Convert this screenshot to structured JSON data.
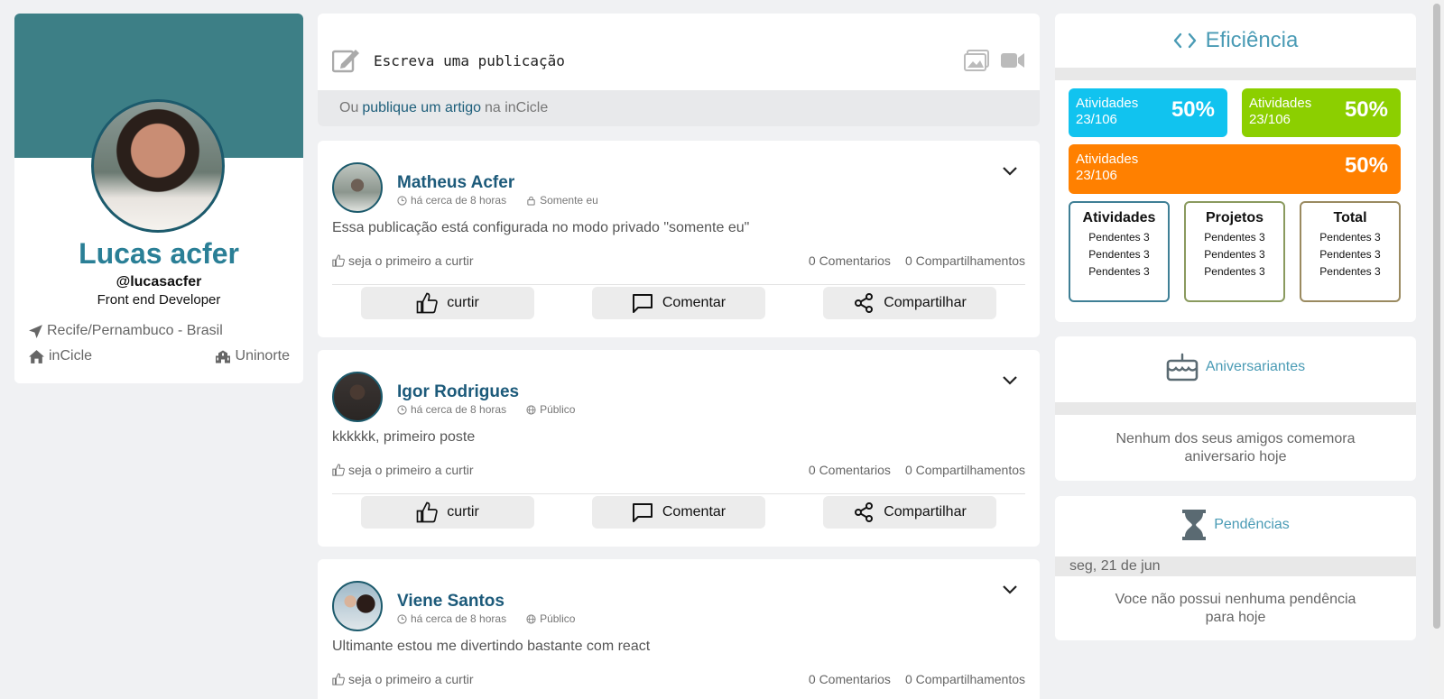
{
  "profile": {
    "name": "Lucas acfer",
    "handle": "@lucasacfer",
    "role": "Front end Developer",
    "location": "Recife/Pernambuco - Brasil",
    "organization": "inCicle",
    "university": "Uninorte"
  },
  "compose": {
    "placeholder": "Escreva uma publicação",
    "bottom_prefix": "Ou",
    "bottom_link": "publique um artigo",
    "bottom_suffix": "na inCicle"
  },
  "posts": [
    {
      "author": "Matheus Acfer",
      "time": "há cerca de 8 horas",
      "visibility": "Somente eu",
      "text": "Essa publicação está configurada no modo privado \"somente eu\"",
      "likes": "seja o primeiro a curtir",
      "comments": "0 Comentarios",
      "shares": "0 Compartilhamentos",
      "like_label": "curtir",
      "comment_label": "Comentar",
      "share_label": "Compartilhar"
    },
    {
      "author": "Igor Rodrigues",
      "time": "há cerca de 8 horas",
      "visibility": "Público",
      "text": "kkkkkk, primeiro poste",
      "likes": "seja o primeiro a curtir",
      "comments": "0 Comentarios",
      "shares": "0 Compartilhamentos",
      "like_label": "curtir",
      "comment_label": "Comentar",
      "share_label": "Compartilhar"
    },
    {
      "author": "Viene Santos",
      "time": "há cerca de 8 horas",
      "visibility": "Público",
      "text": "Ultimante estou me divertindo bastante com react",
      "likes": "seja o primeiro a curtir",
      "comments": "0 Comentarios",
      "shares": "0 Compartilhamentos"
    }
  ],
  "efficiency": {
    "title": "Eficiência",
    "tiles": [
      {
        "label": "Atividades",
        "count": "23/106",
        "percent": "50%",
        "color": "#11c3ef"
      },
      {
        "label": "Atividades",
        "count": "23/106",
        "percent": "50%",
        "color": "#8ccf00"
      },
      {
        "label": "Atividades",
        "count": "23/106",
        "percent": "50%",
        "color": "#ff8000"
      }
    ],
    "boxes": [
      {
        "title": "Atividades",
        "lines": [
          "Pendentes 3",
          "Pendentes 3",
          "Pendentes 3"
        ],
        "border": "#3f7f95"
      },
      {
        "title": "Projetos",
        "lines": [
          "Pendentes 3",
          "Pendentes 3",
          "Pendentes 3"
        ],
        "border": "#8a9a5e"
      },
      {
        "title": "Total",
        "lines": [
          "Pendentes 3",
          "Pendentes 3",
          "Pendentes 3"
        ],
        "border": "#9a8a60"
      }
    ]
  },
  "birthdays": {
    "title": "Aniversariantes",
    "message_line1": "Nenhum dos seus amigos comemora",
    "message_line2": "aniversario hoje"
  },
  "pending": {
    "title": "Pendências",
    "date": "seg, 21 de jun",
    "message_line1": "Voce não possui nenhuma pendência",
    "message_line2": "para hoje"
  }
}
